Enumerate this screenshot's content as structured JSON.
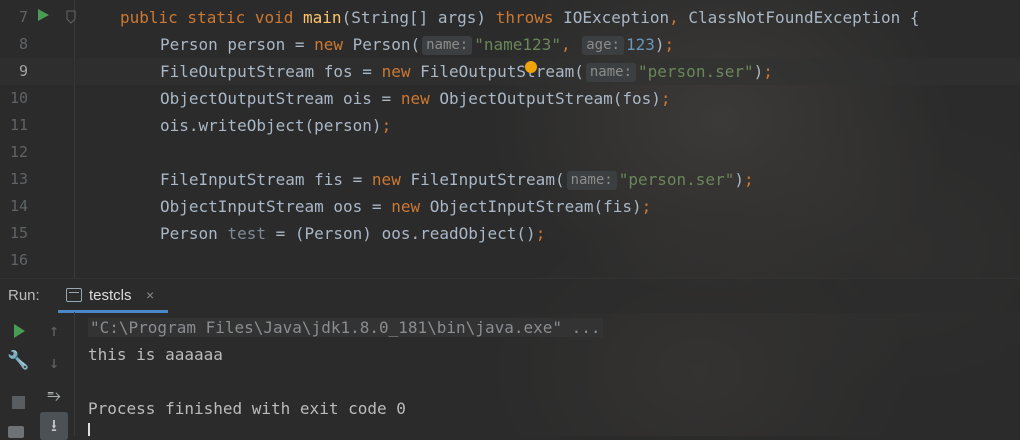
{
  "editor": {
    "lines": [
      {
        "num": "7",
        "tokens": [
          {
            "t": "public static void ",
            "c": "kw"
          },
          {
            "t": "main",
            "c": "fn"
          },
          {
            "t": "(String[] args) ",
            "c": ""
          },
          {
            "t": "throws ",
            "c": "kw"
          },
          {
            "t": "IOException",
            "c": ""
          },
          {
            "t": ", ",
            "c": "pun"
          },
          {
            "t": "ClassNotFoundException {",
            "c": ""
          }
        ]
      },
      {
        "num": "8",
        "indent": 1,
        "tokens": [
          {
            "t": "Person person = ",
            "c": ""
          },
          {
            "t": "new ",
            "c": "kw"
          },
          {
            "t": "Person(",
            "c": ""
          },
          {
            "t": "name:",
            "c": "hint"
          },
          {
            "t": "\"name123\"",
            "c": "str"
          },
          {
            "t": ", ",
            "c": "pun"
          },
          {
            "t": "age:",
            "c": "hint"
          },
          {
            "t": "123",
            "c": "num"
          },
          {
            "t": ")",
            "c": ""
          },
          {
            "t": ";",
            "c": "pun"
          }
        ]
      },
      {
        "num": "9",
        "indent": 1,
        "current": true,
        "tokens": [
          {
            "t": "FileOutputStream fos = ",
            "c": ""
          },
          {
            "t": "new ",
            "c": "kw"
          },
          {
            "t": "FileOutputStream(",
            "c": ""
          },
          {
            "t": "name:",
            "c": "hint"
          },
          {
            "t": "\"person.ser\"",
            "c": "str"
          },
          {
            "t": ")",
            "c": ""
          },
          {
            "t": ";",
            "c": "pun"
          }
        ]
      },
      {
        "num": "10",
        "indent": 1,
        "tokens": [
          {
            "t": "ObjectOutputStream ois = ",
            "c": ""
          },
          {
            "t": "new ",
            "c": "kw"
          },
          {
            "t": "ObjectOutputStream(fos)",
            "c": ""
          },
          {
            "t": ";",
            "c": "pun"
          }
        ]
      },
      {
        "num": "11",
        "indent": 1,
        "tokens": [
          {
            "t": "ois.writeObject(person)",
            "c": ""
          },
          {
            "t": ";",
            "c": "pun"
          }
        ]
      },
      {
        "num": "12",
        "indent": 1,
        "tokens": []
      },
      {
        "num": "13",
        "indent": 1,
        "tokens": [
          {
            "t": "FileInputStream fis = ",
            "c": ""
          },
          {
            "t": "new ",
            "c": "kw"
          },
          {
            "t": "FileInputStream(",
            "c": ""
          },
          {
            "t": "name:",
            "c": "hint"
          },
          {
            "t": "\"person.ser\"",
            "c": "str"
          },
          {
            "t": ")",
            "c": ""
          },
          {
            "t": ";",
            "c": "pun"
          }
        ]
      },
      {
        "num": "14",
        "indent": 1,
        "tokens": [
          {
            "t": "ObjectInputStream oos = ",
            "c": ""
          },
          {
            "t": "new ",
            "c": "kw"
          },
          {
            "t": "ObjectInputStream(fis)",
            "c": ""
          },
          {
            "t": ";",
            "c": "pun"
          }
        ]
      },
      {
        "num": "15",
        "indent": 1,
        "tokens": [
          {
            "t": "Person ",
            "c": ""
          },
          {
            "t": "test",
            "c": "var"
          },
          {
            "t": " = (Person) oos.readObject()",
            "c": ""
          },
          {
            "t": ";",
            "c": "pun"
          }
        ]
      },
      {
        "num": "16",
        "indent": 1,
        "tokens": []
      }
    ]
  },
  "run_panel": {
    "label": "Run:",
    "tab_label": "testcls",
    "tab_close": "×",
    "icons": [
      "play-icon",
      "arrow-up-icon",
      "wrench-icon",
      "arrow-down-icon",
      "stop-icon",
      "soft-wrap-icon",
      "scroll-to-end-icon",
      "camera-icon"
    ],
    "console_lines": [
      {
        "text": "\"C:\\Program Files\\Java\\jdk1.8.0_181\\bin\\java.exe\" ...",
        "style": "cmd"
      },
      {
        "text": "this is aaaaaa",
        "style": "out"
      },
      {
        "text": "",
        "style": "out"
      },
      {
        "text": "Process finished with exit code 0",
        "style": "out"
      }
    ]
  },
  "colors": {
    "keyword": "#cc7832",
    "string": "#6a8759",
    "number": "#6897bb",
    "method": "#ffc66d",
    "accent": "#4a88c7",
    "run_green": "#499c54"
  }
}
